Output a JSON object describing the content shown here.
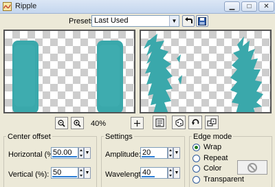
{
  "window": {
    "title": "Ripple"
  },
  "presets": {
    "label": "Presets:",
    "value": "Last Used"
  },
  "zoom": {
    "value": "40%"
  },
  "center_offset": {
    "title": "Center offset",
    "horizontal_label": "Horizontal (%):",
    "horizontal_value": "50.00",
    "vertical_label": "Vertical (%):",
    "vertical_value": "50"
  },
  "settings": {
    "title": "Settings",
    "amplitude_label": "Amplitude:",
    "amplitude_value": "20",
    "wavelength_label": "Wavelength:",
    "wavelength_value": "40"
  },
  "edge_mode": {
    "title": "Edge mode",
    "options": [
      "Wrap",
      "Repeat",
      "Color",
      "Transparent"
    ],
    "selected": "Wrap"
  },
  "colors": {
    "accent": "#2a7dd6",
    "shape_teal": "#3aa8ab"
  }
}
